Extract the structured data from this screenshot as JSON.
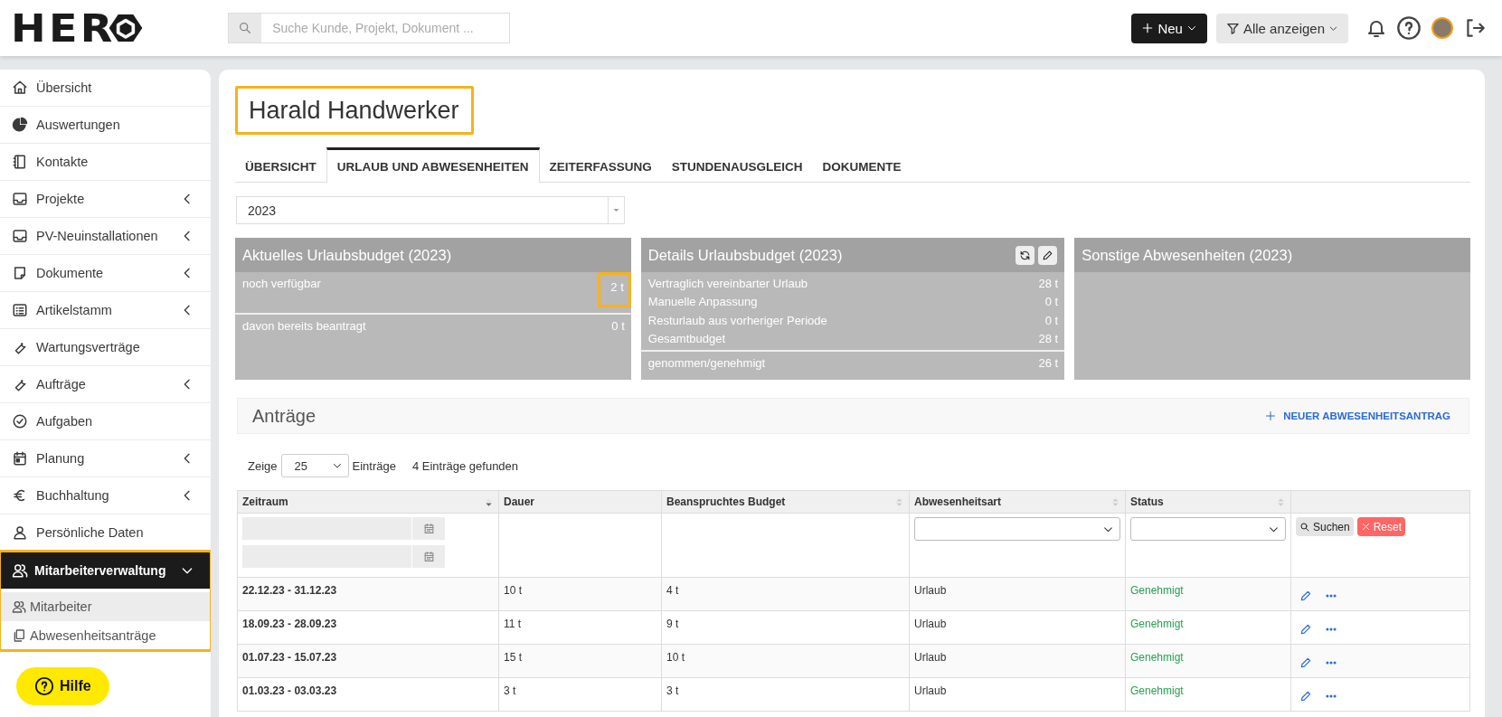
{
  "header": {
    "logo": "HER",
    "search": {
      "placeholder": "Suche Kunde, Projekt, Dokument ..."
    },
    "new_button": "Neu",
    "filter_button": "Alle anzeigen"
  },
  "sidebar": {
    "items": [
      {
        "label": "Übersicht",
        "kind": "link",
        "selected": false
      },
      {
        "label": "Auswertungen",
        "kind": "link",
        "selected": false
      },
      {
        "label": "Kontakte",
        "kind": "link",
        "selected": false
      },
      {
        "label": "Projekte",
        "kind": "group",
        "selected": false,
        "expanded": false
      },
      {
        "label": "PV-Neuinstallationen",
        "kind": "group",
        "selected": false,
        "expanded": false
      },
      {
        "label": "Dokumente",
        "kind": "group",
        "selected": false,
        "expanded": false
      },
      {
        "label": "Artikelstamm",
        "kind": "group",
        "selected": false,
        "expanded": false
      },
      {
        "label": "Wartungsverträge",
        "kind": "link",
        "selected": false
      },
      {
        "label": "Aufträge",
        "kind": "group",
        "selected": false,
        "expanded": false
      },
      {
        "label": "Aufgaben",
        "kind": "link",
        "selected": false
      },
      {
        "label": "Planung",
        "kind": "group",
        "selected": false,
        "expanded": false
      },
      {
        "label": "Buchhaltung",
        "kind": "group",
        "selected": false,
        "expanded": false
      },
      {
        "label": "Persönliche Daten",
        "kind": "link",
        "selected": false
      },
      {
        "label": "Mitarbeiterverwaltung",
        "kind": "group",
        "selected": true,
        "expanded": true,
        "highlighted": true,
        "children": [
          {
            "label": "Mitarbeiter",
            "selected": true
          },
          {
            "label": "Abwesenheitsanträge",
            "selected": false
          }
        ]
      }
    ]
  },
  "help_button": "Hilfe",
  "main": {
    "title": {
      "text": "Harald Handwerker",
      "highlighted": true
    },
    "tabs": [
      {
        "label": "ÜBERSICHT",
        "selected": false
      },
      {
        "label": "URLAUB UND ABWESENHEITEN",
        "selected": true
      },
      {
        "label": "ZEITERFASSUNG",
        "selected": false
      },
      {
        "label": "STUNDENAUSGLEICH",
        "selected": false
      },
      {
        "label": "DOKUMENTE",
        "selected": false
      }
    ],
    "year_select": {
      "value": "2023"
    },
    "cards": [
      {
        "title": "Aktuelles Urlaubsbudget (2023)",
        "actions": false,
        "sections": [
          [
            {
              "label": "noch verfügbar",
              "value": "2 t",
              "highlighted": true
            }
          ],
          [
            {
              "label": "davon bereits beantragt",
              "value": "0 t",
              "highlighted": false
            }
          ]
        ]
      },
      {
        "title": "Details Urlaubsbudget (2023)",
        "actions": true,
        "sections": [
          [
            {
              "label": "Vertraglich vereinbarter Urlaub",
              "value": "28 t",
              "highlighted": false
            },
            {
              "label": "Manuelle Anpassung",
              "value": "0 t",
              "highlighted": false
            },
            {
              "label": "Resturlaub aus vorheriger Periode",
              "value": "0 t",
              "highlighted": false
            },
            {
              "label": "Gesamtbudget",
              "value": "28 t",
              "highlighted": false
            }
          ],
          [
            {
              "label": "genommen/genehmigt",
              "value": "26 t",
              "highlighted": false
            }
          ]
        ]
      },
      {
        "title": "Sonstige Abwesenheiten (2023)",
        "actions": false
      }
    ],
    "requests": {
      "title": "Anträge",
      "new_button": "NEUER ABWESENHEITSANTRAG",
      "length": {
        "prefix": "Zeige",
        "value": "25",
        "suffix": "Einträge",
        "found": "4 Einträge gefunden"
      },
      "columns": [
        {
          "label": "Zeitraum",
          "sortable": true,
          "sorted": true
        },
        {
          "label": "Dauer",
          "sortable": false,
          "sorted": false
        },
        {
          "label": "Beanspruchtes Budget",
          "sortable": true,
          "sorted": false
        },
        {
          "label": "Abwesenheitsart",
          "sortable": true,
          "sorted": false
        },
        {
          "label": "Status",
          "sortable": true,
          "sorted": false
        },
        {
          "sortable": false,
          "sorted": false
        }
      ],
      "filters": [
        {
          "kind": "date-range"
        },
        {
          "kind": "empty"
        },
        {
          "kind": "empty"
        },
        {
          "kind": "select"
        },
        {
          "kind": "select"
        },
        {
          "kind": "buttons"
        }
      ],
      "search_button": "Suchen",
      "reset_button": "Reset",
      "rows": [
        {
          "period": "22.12.23 - 31.12.23",
          "duration": "10 t",
          "budget": "4 t",
          "type": "Urlaub",
          "status": "Genehmigt"
        },
        {
          "period": "18.09.23 - 28.09.23",
          "duration": "11 t",
          "budget": "9 t",
          "type": "Urlaub",
          "status": "Genehmigt"
        },
        {
          "period": "01.07.23 - 15.07.23",
          "duration": "15 t",
          "budget": "10 t",
          "type": "Urlaub",
          "status": "Genehmigt"
        },
        {
          "period": "01.03.23 - 03.03.23",
          "duration": "3 t",
          "budget": "3 t",
          "type": "Urlaub",
          "status": "Genehmigt"
        }
      ]
    }
  }
}
